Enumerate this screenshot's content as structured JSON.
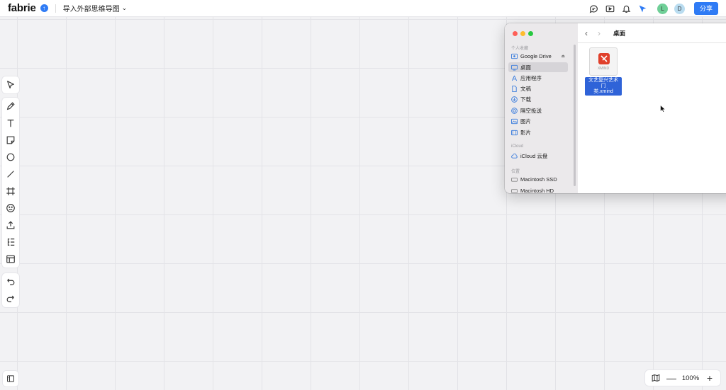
{
  "app": {
    "logo": "fabrie",
    "badge": "↑",
    "doc_title": "导入外部思维导图"
  },
  "header": {
    "avatars": [
      {
        "letter": "L",
        "color": "#6fcf97"
      },
      {
        "letter": "D",
        "color": "#b9dcf0"
      }
    ],
    "share_label": "分享"
  },
  "zoom": {
    "value": "100%",
    "minus": "—",
    "plus": "+"
  },
  "finder": {
    "title": "桌面",
    "sidebar": {
      "favorites_label": "个人收藏",
      "favorites": [
        "Google Drive",
        "桌面",
        "应用程序",
        "文稿",
        "下载",
        "隔空投送",
        "图片",
        "影片"
      ],
      "icloud_label": "iCloud",
      "icloud": [
        "iCloud 云盘"
      ],
      "locations_label": "位置",
      "locations": [
        "Macintosh SSD",
        "Macintosh HD"
      ]
    },
    "file": {
      "name": "文艺复兴艺术门类.xmind",
      "name_line1": "文艺复兴艺术门",
      "name_line2": "类.xmind",
      "logo_text": "XMIND"
    }
  }
}
